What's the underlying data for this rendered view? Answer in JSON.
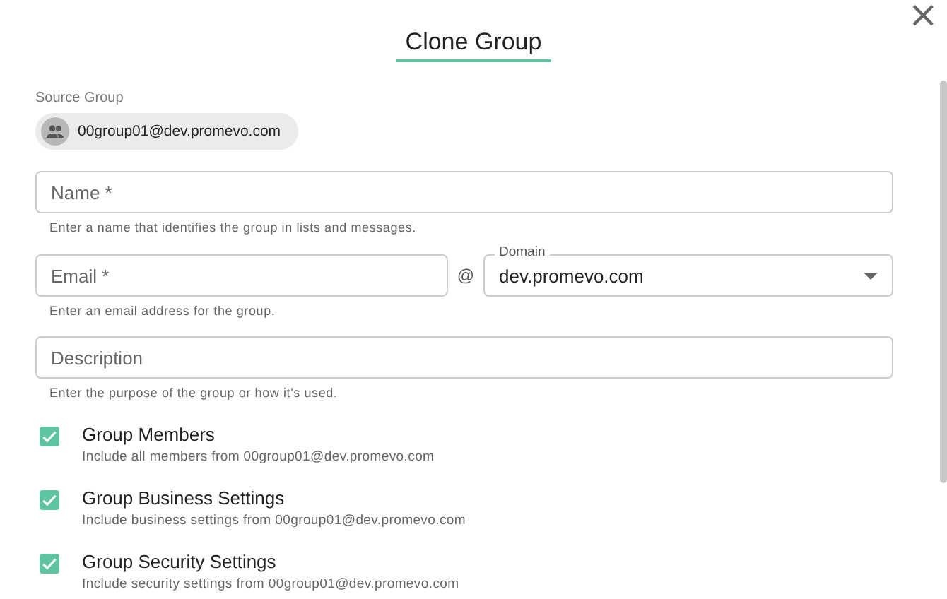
{
  "dialog": {
    "title": "Clone Group",
    "close_icon": "×"
  },
  "source_group": {
    "label": "Source Group",
    "chip": "00group01@dev.promevo.com"
  },
  "fields": [
    {
      "kind": "text",
      "placeholder": "Name *",
      "helper": "Enter a name that identifies the group in lists and messages."
    },
    {
      "kind": "email",
      "placeholder": "Email *",
      "helper": "Enter an email address for the group.",
      "separator": "@",
      "domain_label": "Domain",
      "domain_value": "dev.promevo.com"
    },
    {
      "kind": "text",
      "placeholder": "Description",
      "helper": "Enter the purpose of the group or how it's used."
    }
  ],
  "options": [
    {
      "label": "Group Members",
      "description": "Include all members from 00group01@dev.promevo.com",
      "checked": true
    },
    {
      "label": "Group Business Settings",
      "description": "Include business settings from 00group01@dev.promevo.com",
      "checked": true
    },
    {
      "label": "Group Security Settings",
      "description": "Include security settings from 00group01@dev.promevo.com",
      "checked": true
    }
  ]
}
